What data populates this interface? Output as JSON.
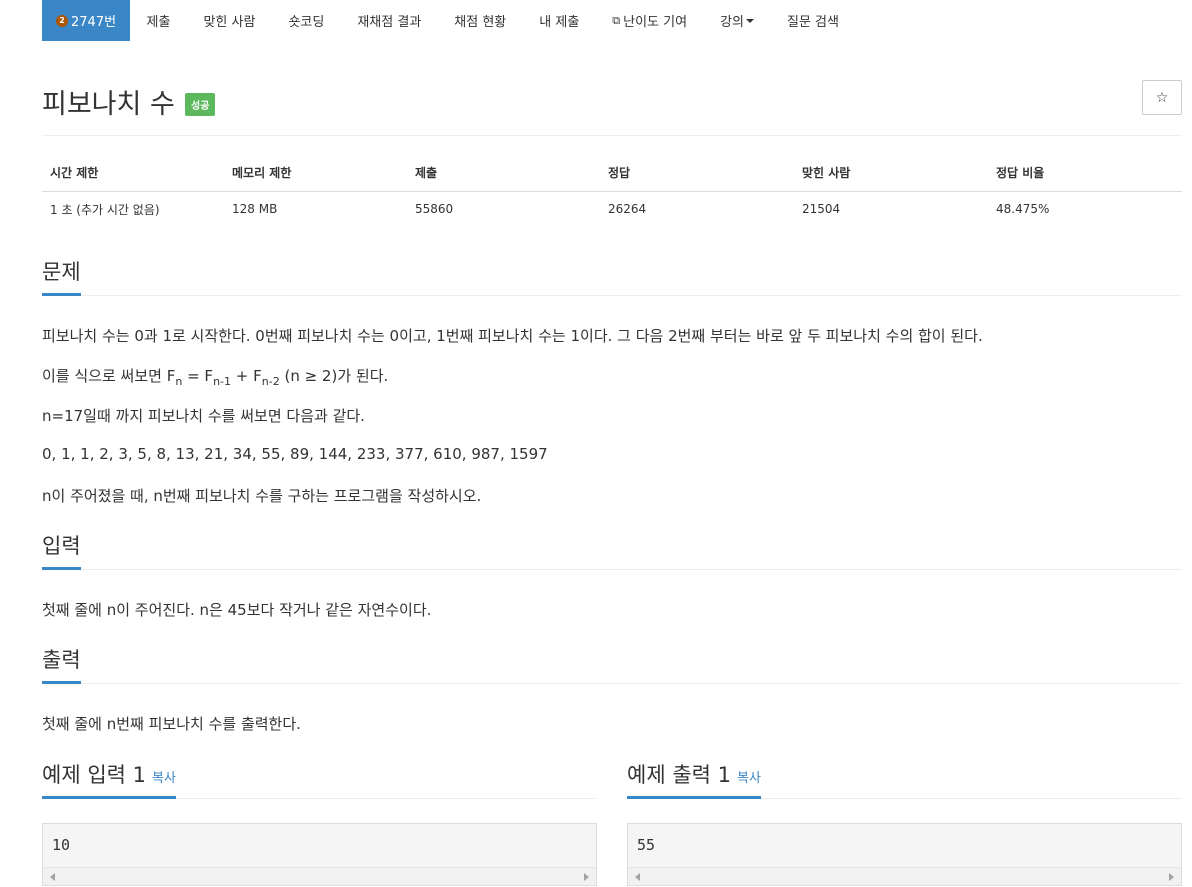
{
  "nav": {
    "problem_number": "2747번",
    "tier_level": "2",
    "items": [
      "제출",
      "맞힌 사람",
      "숏코딩",
      "재채점 결과",
      "채점 현황",
      "내 제출",
      "난이도 기여",
      "강의",
      "질문 검색"
    ]
  },
  "title": "피보나치 수",
  "status_badge": "성공",
  "star_icon": "☆",
  "info": {
    "headers": [
      "시간 제한",
      "메모리 제한",
      "제출",
      "정답",
      "맞힌 사람",
      "정답 비율"
    ],
    "values": [
      "1 초 (추가 시간 없음)",
      "128 MB",
      "55860",
      "26264",
      "21504",
      "48.475%"
    ]
  },
  "sections": {
    "problem": {
      "title": "문제",
      "p1": "피보나치 수는 0과 1로 시작한다. 0번째 피보나치 수는 0이고, 1번째 피보나치 수는 1이다. 그 다음 2번째 부터는 바로 앞 두 피보나치 수의 합이 된다.",
      "p2_prefix": "이를 식으로 써보면 F",
      "p2_sub1": "n",
      "p2_mid1": " = F",
      "p2_sub2": "n-1",
      "p2_mid2": " + F",
      "p2_sub3": "n-2",
      "p2_suffix": " (n ≥ 2)가 된다.",
      "p3": "n=17일때 까지 피보나치 수를 써보면 다음과 같다.",
      "p4": "0, 1, 1, 2, 3, 5, 8, 13, 21, 34, 55, 89, 144, 233, 377, 610, 987, 1597",
      "p5": "n이 주어졌을 때, n번째 피보나치 수를 구하는 프로그램을 작성하시오."
    },
    "input": {
      "title": "입력",
      "text": "첫째 줄에 n이 주어진다. n은 45보다 작거나 같은 자연수이다."
    },
    "output": {
      "title": "출력",
      "text": "첫째 줄에 n번째 피보나치 수를 출력한다."
    },
    "sample_input": {
      "title": "예제 입력 1",
      "copy": "복사",
      "value": "10"
    },
    "sample_output": {
      "title": "예제 출력 1",
      "copy": "복사",
      "value": "55"
    }
  },
  "colors": {
    "accent": "#3a87c8",
    "success": "#5cb85c",
    "tier": "#ad5600"
  }
}
